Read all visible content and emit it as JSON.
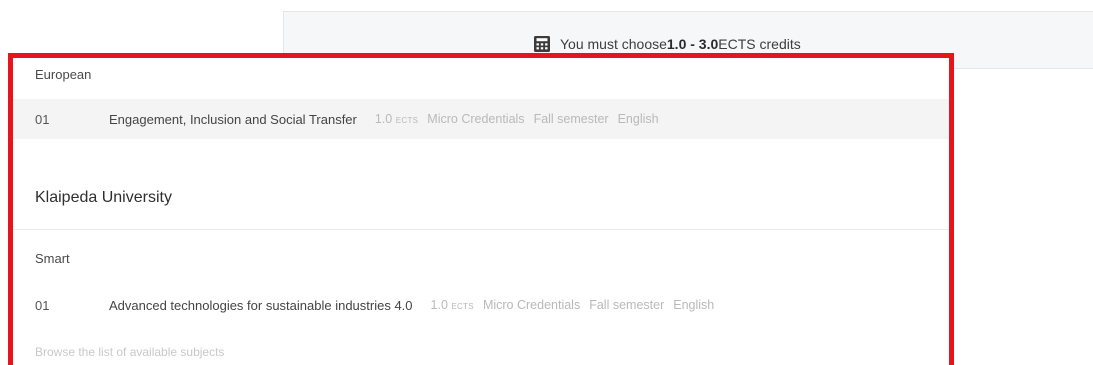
{
  "banner": {
    "prefix": "You must choose ",
    "range": "1.0 - 3.0",
    "suffix": " ECTS credits",
    "icon": "calculator-icon"
  },
  "groups": [
    {
      "label": "European",
      "subjects": [
        {
          "number": "01",
          "title": "Engagement, Inclusion and Social Transfer",
          "credits": "1.0",
          "credits_unit": "ECTS",
          "type": "Micro Credentials",
          "semester": "Fall semester",
          "language": "English"
        }
      ]
    }
  ],
  "university": {
    "name": "Klaipeda University",
    "groups": [
      {
        "label": "Smart",
        "subjects": [
          {
            "number": "01",
            "title": "Advanced technologies for sustainable industries 4.0",
            "credits": "1.0",
            "credits_unit": "ECTS",
            "type": "Micro Credentials",
            "semester": "Fall semester",
            "language": "English"
          }
        ]
      }
    ]
  },
  "browse_link": "Browse the list of available subjects",
  "colors": {
    "highlight": "#e8141c",
    "muted_text": "#b9b9b9"
  }
}
